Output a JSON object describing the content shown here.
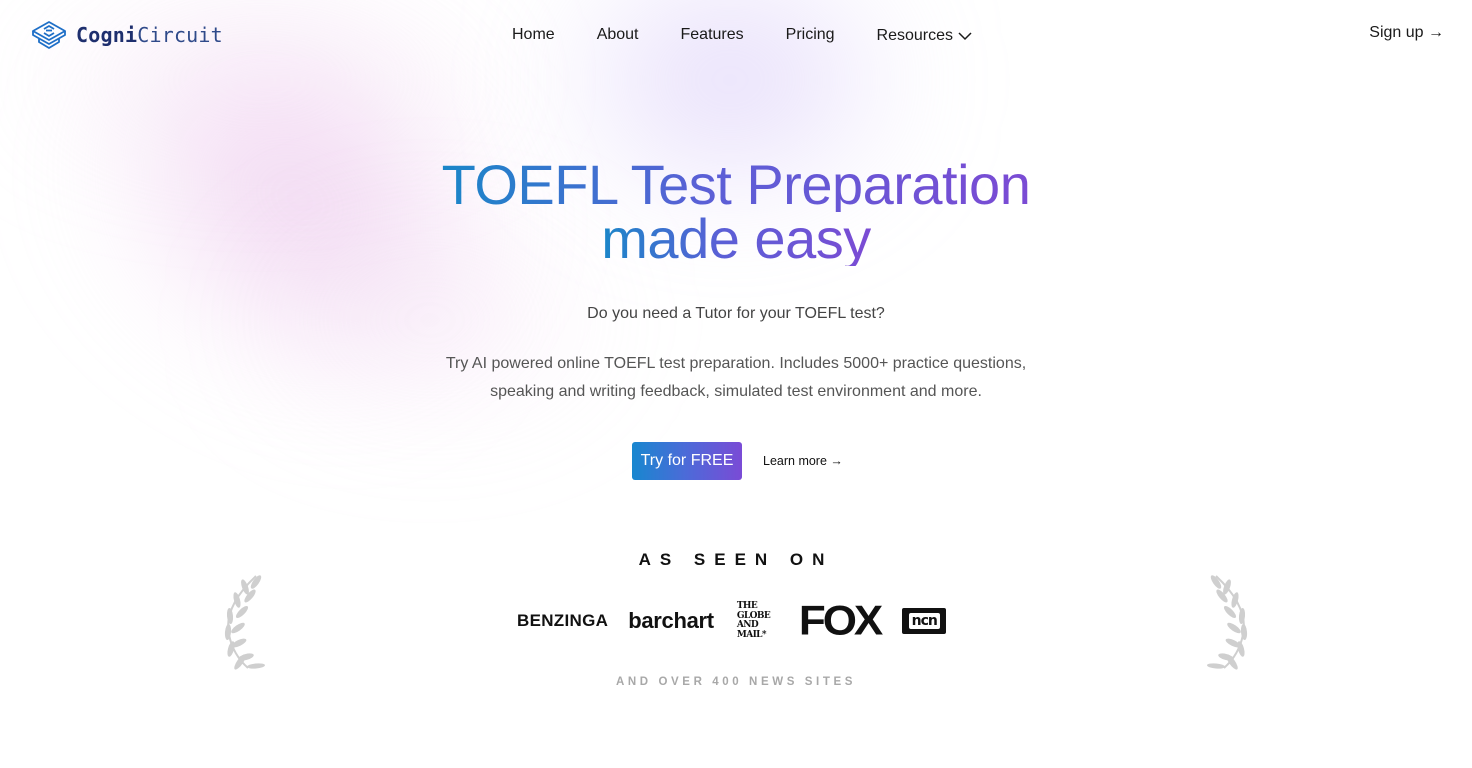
{
  "brand": {
    "name_bold": "Cogni",
    "name_light": "Circuit",
    "logo_icon": "circuit-cube-icon"
  },
  "nav": {
    "items": [
      {
        "label": "Home"
      },
      {
        "label": "About"
      },
      {
        "label": "Features"
      },
      {
        "label": "Pricing"
      },
      {
        "label": "Resources",
        "icon": "chevron-down-icon"
      }
    ],
    "signup_label": "Sign up →"
  },
  "hero": {
    "title_line1": "TOEFL Test Preparation",
    "title_line2": "made easy",
    "subtitle": "Do you need a Tutor for your TOEFL test?",
    "description": "Try AI powered online TOEFL test preparation. Includes 5000+ practice questions, speaking and writing feedback, simulated test environment and more.",
    "cta_primary": "Try for FREE",
    "cta_secondary": "Learn more →"
  },
  "press": {
    "heading": "AS SEEN ON",
    "logos": [
      {
        "name": "BENZINGA"
      },
      {
        "name": "barchart"
      },
      {
        "name": "THE GLOBE AND MAIL",
        "lines": [
          "THE",
          "GLOBE",
          "AND",
          "MAIL*"
        ]
      },
      {
        "name": "FOX"
      },
      {
        "name": "ncn"
      }
    ],
    "footer_note": "AND OVER 400 NEWS SITES"
  },
  "colors": {
    "gradient_start": "#1a86c8",
    "gradient_mid": "#5b5fd6",
    "gradient_end": "#7b4bd4",
    "logo_navy": "#1e2f6e",
    "muted_gray": "#a8a8a8"
  }
}
